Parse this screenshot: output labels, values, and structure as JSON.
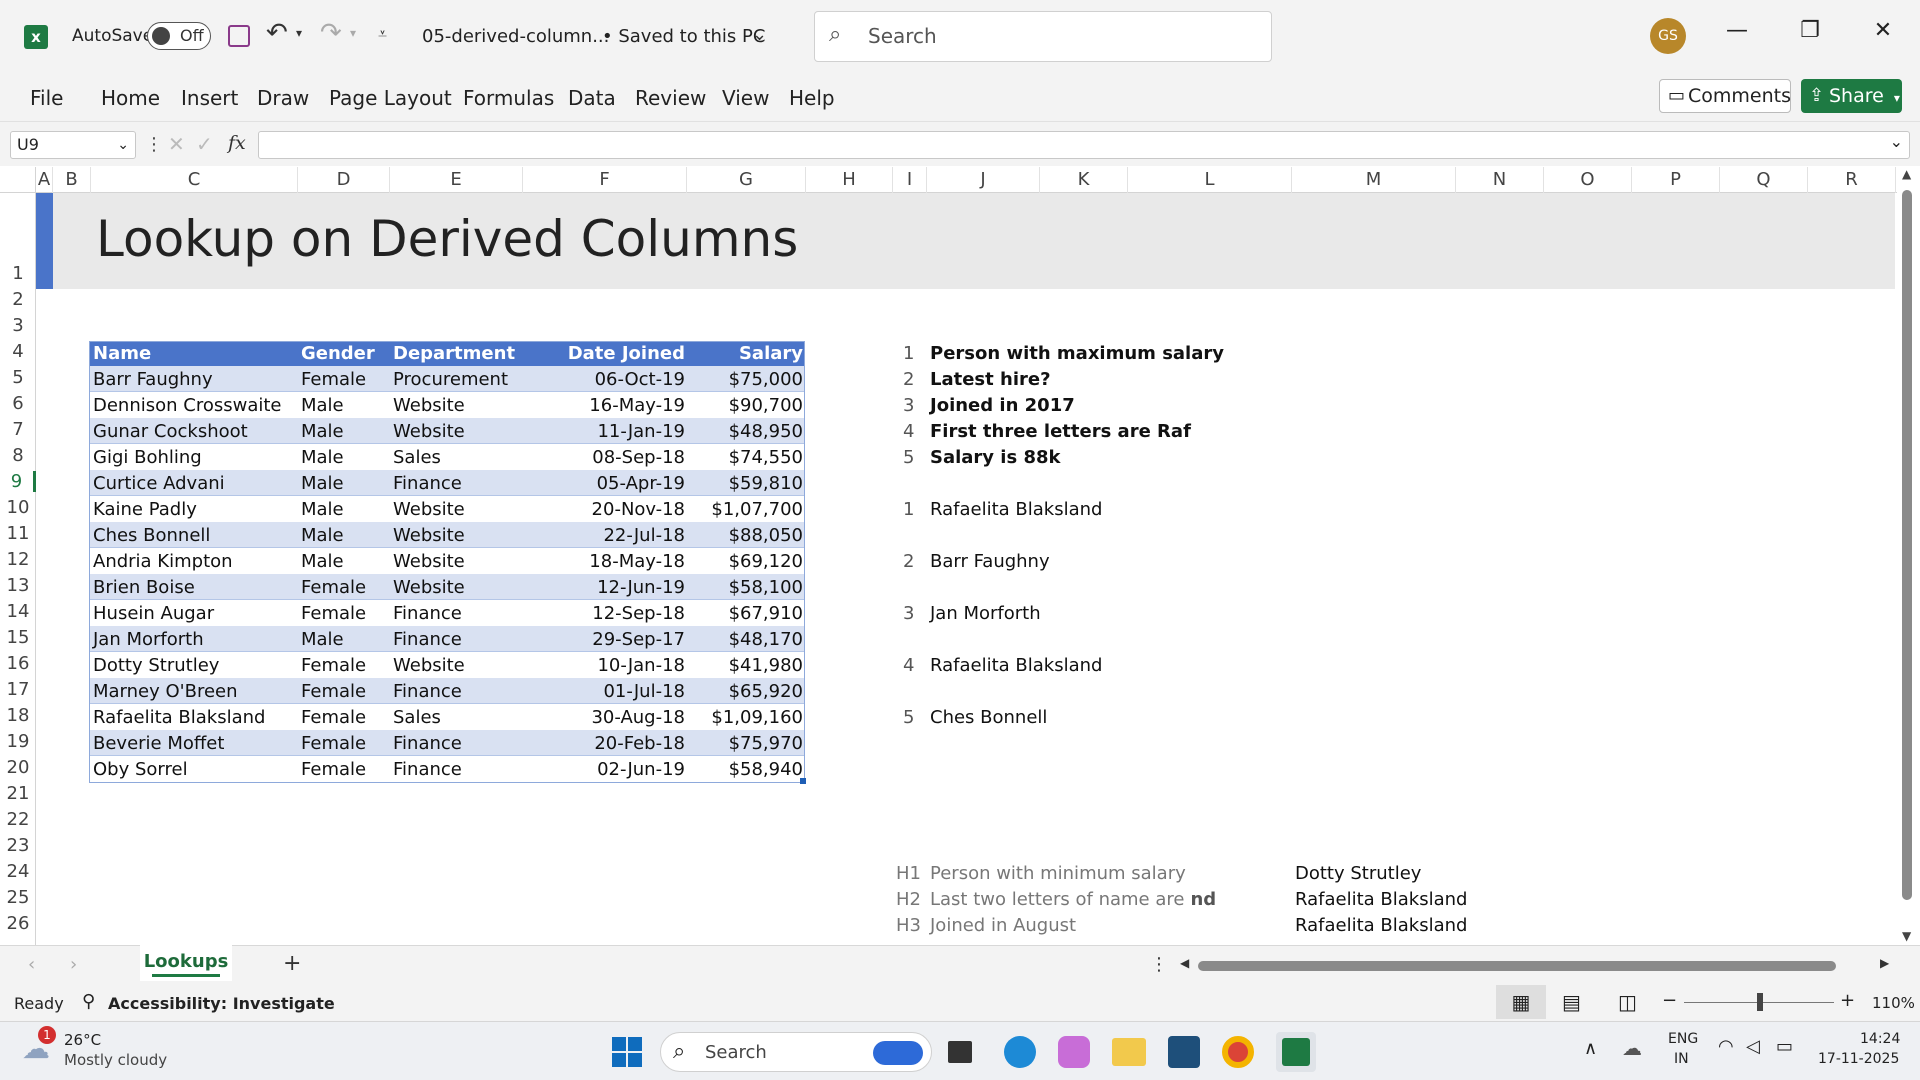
{
  "app": {
    "autosave_label": "AutoSave",
    "autosave_state": "Off",
    "file_name": "05-derived-column...",
    "save_status": "• Saved to this PC",
    "search_placeholder": "Search",
    "user_initials": "GS",
    "brand_color": "#1e7a43"
  },
  "menu": [
    "File",
    "Home",
    "Insert",
    "Draw",
    "Page Layout",
    "Formulas",
    "Data",
    "Review",
    "View",
    "Help"
  ],
  "actions": {
    "comments": "Comments",
    "share": "Share"
  },
  "formula_bar": {
    "name_box": "U9",
    "fx": "fx",
    "value": ""
  },
  "columns": [
    "A",
    "B",
    "C",
    "D",
    "E",
    "F",
    "G",
    "H",
    "I",
    "J",
    "K",
    "L",
    "M",
    "N",
    "O",
    "P",
    "Q",
    "R"
  ],
  "rows": [
    "1",
    "2",
    "3",
    "4",
    "5",
    "6",
    "7",
    "8",
    "9",
    "10",
    "11",
    "12",
    "13",
    "14",
    "15",
    "16",
    "17",
    "18",
    "19",
    "20",
    "21",
    "22",
    "23",
    "24",
    "25",
    "26"
  ],
  "sheet_title": "Lookup on Derived Columns",
  "table": {
    "headers": [
      "Name",
      "Gender",
      "Department",
      "Date Joined",
      "Salary"
    ],
    "rows": [
      [
        "Barr Faughny",
        "Female",
        "Procurement",
        "06-Oct-19",
        "$75,000"
      ],
      [
        "Dennison Crosswaite",
        "Male",
        "Website",
        "16-May-19",
        "$90,700"
      ],
      [
        "Gunar Cockshoot",
        "Male",
        "Website",
        "11-Jan-19",
        "$48,950"
      ],
      [
        "Gigi Bohling",
        "Male",
        "Sales",
        "08-Sep-18",
        "$74,550"
      ],
      [
        "Curtice Advani",
        "Male",
        "Finance",
        "05-Apr-19",
        "$59,810"
      ],
      [
        "Kaine Padly",
        "Male",
        "Website",
        "20-Nov-18",
        "$1,07,700"
      ],
      [
        "Ches Bonnell",
        "Male",
        "Website",
        "22-Jul-18",
        "$88,050"
      ],
      [
        "Andria Kimpton",
        "Male",
        "Website",
        "18-May-18",
        "$69,120"
      ],
      [
        "Brien Boise",
        "Female",
        "Website",
        "12-Jun-19",
        "$58,100"
      ],
      [
        "Husein Augar",
        "Female",
        "Finance",
        "12-Sep-18",
        "$67,910"
      ],
      [
        "Jan Morforth",
        "Male",
        "Finance",
        "29-Sep-17",
        "$48,170"
      ],
      [
        "Dotty Strutley",
        "Female",
        "Website",
        "10-Jan-18",
        "$41,980"
      ],
      [
        "Marney O'Breen",
        "Female",
        "Finance",
        "01-Jul-18",
        "$65,920"
      ],
      [
        "Rafaelita Blaksland",
        "Female",
        "Sales",
        "30-Aug-18",
        "$1,09,160"
      ],
      [
        "Beverie Moffet",
        "Female",
        "Finance",
        "20-Feb-18",
        "$75,970"
      ],
      [
        "Oby Sorrel",
        "Female",
        "Finance",
        "02-Jun-19",
        "$58,940"
      ]
    ],
    "header_color": "#4a74c9",
    "band_color": "#d9e1f2"
  },
  "questions": [
    {
      "n": "1",
      "text": "Person with maximum salary"
    },
    {
      "n": "2",
      "text": "Latest hire?"
    },
    {
      "n": "3",
      "text": "Joined in 2017"
    },
    {
      "n": "4",
      "text": "First three letters are Raf"
    },
    {
      "n": "5",
      "text": "Salary is 88k"
    }
  ],
  "answers": [
    {
      "n": "1",
      "text": "Rafaelita Blaksland"
    },
    {
      "n": "2",
      "text": "Barr Faughny"
    },
    {
      "n": "3",
      "text": "Jan Morforth"
    },
    {
      "n": "4",
      "text": "Rafaelita Blaksland"
    },
    {
      "n": "5",
      "text": "Ches Bonnell"
    }
  ],
  "homework": [
    {
      "n": "H1",
      "text": "Person with minimum salary",
      "text_bold": "",
      "answer": "Dotty Strutley"
    },
    {
      "n": "H2",
      "text": "Last two letters of name are",
      "text_bold": "nd",
      "answer": "Rafaelita Blaksland"
    },
    {
      "n": "H3",
      "text": "Joined in August",
      "text_bold": "",
      "answer": "Rafaelita Blaksland"
    }
  ],
  "sheet_tab": "Lookups",
  "status": {
    "ready": "Ready",
    "accessibility": "Accessibility: Investigate",
    "zoom": "110%"
  },
  "taskbar": {
    "weather_temp": "26°C",
    "weather_desc": "Mostly cloudy",
    "weather_badge": "1",
    "search": "Search",
    "lang_top": "ENG",
    "lang_bottom": "IN",
    "time": "14:24",
    "date": "17-11-2025"
  }
}
